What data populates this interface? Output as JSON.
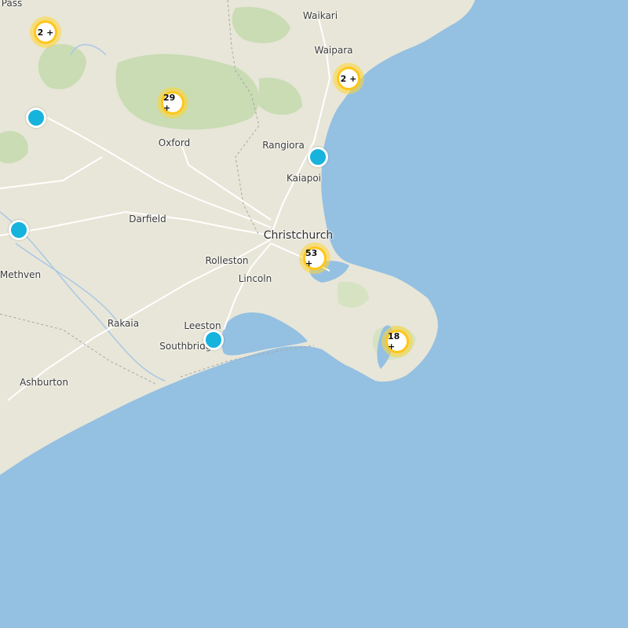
{
  "map": {
    "colors": {
      "land": "#e8e6d8",
      "water": "#94c0e2",
      "park": "#c9dcb4",
      "road": "#ffffff",
      "cluster_ring": "#ffc61a",
      "pin": "#16b3dc"
    },
    "places": {
      "pass": "Pass",
      "waikari": "Waikari",
      "waipara": "Waipara",
      "oxford": "Oxford",
      "rangiora": "Rangiora",
      "kaiapoi": "Kaiapoi",
      "darfield": "Darfield",
      "christchurch": "Christchurch",
      "rolleston": "Rolleston",
      "lincoln": "Lincoln",
      "methven": "Methven",
      "rakaia": "Rakaia",
      "leeston": "Leeston",
      "southbridge": "Southbridge",
      "ashburton": "Ashburton"
    },
    "clusters": {
      "north_west": "2 +",
      "waipara": "2 +",
      "oxford": "29 +",
      "christchurch": "53 +",
      "akaroa": "18 +"
    }
  }
}
